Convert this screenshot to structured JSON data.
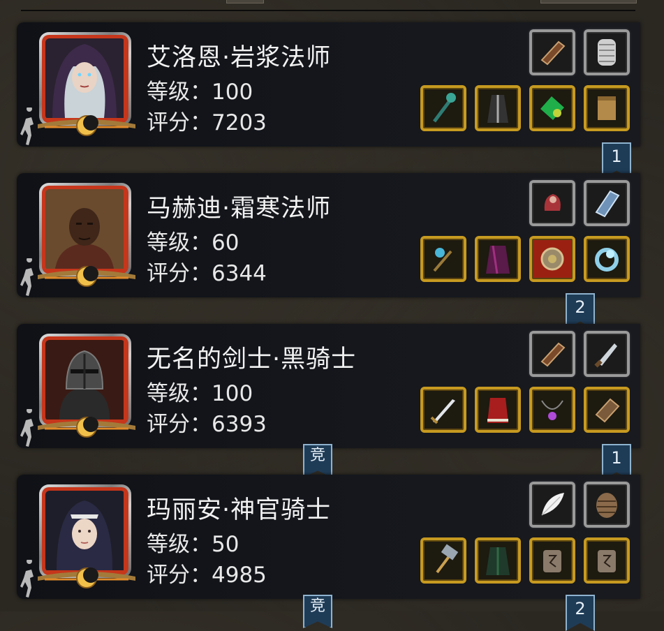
{
  "heroes": [
    {
      "name": "艾洛恩·岩浆法师",
      "level_text": "等级：100",
      "score_text": "评分：7203",
      "rank": "1",
      "items_top": [
        "bracer-icon",
        "chainmail-icon"
      ],
      "items_bottom": [
        "staff-icon",
        "robe-icon",
        "emerald-ring-icon",
        "scroll-icon"
      ]
    },
    {
      "name": "马赫迪·霜寒法师",
      "level_text": "等级：60",
      "score_text": "评分：6344",
      "rank": "2",
      "items_top": [
        "gauntlet-icon",
        "spellbook-icon"
      ],
      "items_bottom": [
        "scepter-icon",
        "cloak-icon",
        "amulet-icon",
        "ice-ring-icon"
      ]
    },
    {
      "name": "无名的剑士·黑骑士",
      "level_text": "等级：100",
      "score_text": "评分：6393",
      "rank": "1",
      "badge": "竞",
      "items_top": [
        "bracer-icon",
        "dagger-icon"
      ],
      "items_bottom": [
        "sword-icon",
        "red-cape-icon",
        "necklace-icon",
        "gauntlet-icon"
      ]
    },
    {
      "name": "玛丽安·神官骑士",
      "level_text": "等级：50",
      "score_text": "评分：4985",
      "rank": "2",
      "badge": "竞",
      "items_top": [
        "feather-icon",
        "shell-armor-icon"
      ],
      "items_bottom": [
        "hammer-icon",
        "green-robe-icon",
        "rune-stone-icon",
        "rune-stone-icon"
      ]
    }
  ],
  "colors": {
    "portrait_border": "#c6361b",
    "gold_slot": "#c79a20",
    "ribbon": "#1f3c57"
  }
}
